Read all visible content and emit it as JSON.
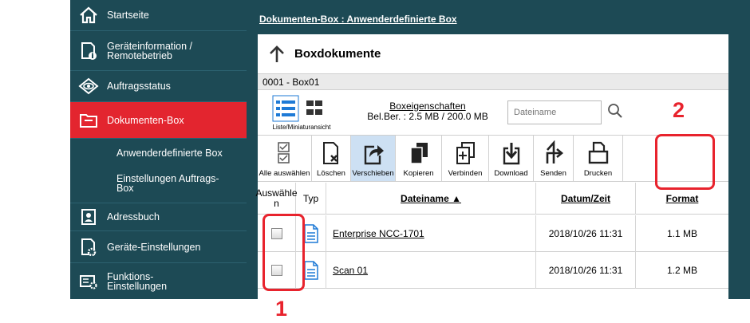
{
  "sidebar": {
    "items": [
      {
        "label": "Startseite",
        "icon": "home-icon"
      },
      {
        "label": "Geräteinformation / Remotebetrieb",
        "icon": "device-info-icon"
      },
      {
        "label": "Auftragsstatus",
        "icon": "eye-icon"
      },
      {
        "label": "Dokumenten-Box",
        "icon": "folder-icon",
        "active": true
      },
      {
        "label": "Adressbuch",
        "icon": "address-book-icon"
      },
      {
        "label": "Geräte-Einstellungen",
        "icon": "device-settings-icon"
      },
      {
        "label": "Funktions-Einstellungen",
        "icon": "function-settings-icon"
      }
    ],
    "subitems": [
      {
        "label": "Anwenderdefinierte Box"
      },
      {
        "label": "Einstellungen Auftrags-Box"
      }
    ]
  },
  "breadcrumb": "Dokumenten-Box : Anwenderdefinierte Box",
  "panel": {
    "title": "Boxdokumente",
    "box_name": "0001 - Box01",
    "view_toggle_label": "Liste/Miniaturansicht",
    "box_props_link": "Boxeigenschaften",
    "box_usage": "Bel.Ber. : 2.5 MB / 200.0 MB",
    "search_placeholder": "Dateiname"
  },
  "toolbar": {
    "buttons": [
      {
        "label": "Alle auswählen",
        "icon": "select-all-icon"
      },
      {
        "label": "Löschen",
        "icon": "delete-icon"
      },
      {
        "label": "Verschieben",
        "icon": "move-icon",
        "active": true
      },
      {
        "label": "Kopieren",
        "icon": "copy-icon"
      },
      {
        "label": "Verbinden",
        "icon": "merge-icon"
      },
      {
        "label": "Download",
        "icon": "download-icon"
      },
      {
        "label": "Senden",
        "icon": "send-icon"
      },
      {
        "label": "Drucken",
        "icon": "print-icon"
      }
    ]
  },
  "table": {
    "headers": {
      "select": "Auswähle\nn",
      "type": "Typ",
      "filename": "Dateiname ▲",
      "datetime": "Datum/Zeit",
      "format": "Format"
    },
    "rows": [
      {
        "name": "Enterprise NCC-1701",
        "datetime": "2018/10/26 11:31",
        "size": "1.1 MB"
      },
      {
        "name": "Scan 01",
        "datetime": "2018/10/26 11:31",
        "size": "1.2 MB"
      }
    ]
  },
  "annotations": {
    "callout_1": "1",
    "callout_2": "2"
  },
  "colors": {
    "sidebar_bg": "#1d4a55",
    "active_item": "#e3252f",
    "callout": "#e8232d",
    "active_button": "#cde0f3"
  }
}
